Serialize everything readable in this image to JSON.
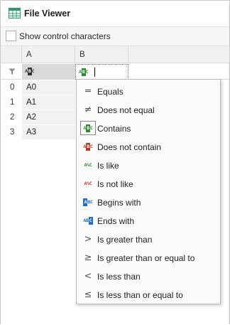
{
  "window": {
    "title": "File Viewer"
  },
  "toolbar": {
    "show_control_characters_label": "Show control characters",
    "show_control_characters_checked": false
  },
  "grid": {
    "columns": [
      "A",
      "B"
    ],
    "rows": [
      {
        "index": "0",
        "a": "A0"
      },
      {
        "index": "1",
        "a": "A1"
      },
      {
        "index": "2",
        "a": "A2"
      },
      {
        "index": "3",
        "a": "A3"
      }
    ],
    "filter": {
      "column_a_operator": "contains",
      "column_b_operator": "contains",
      "column_b_value": ""
    }
  },
  "menu": {
    "items": [
      {
        "label": "Equals",
        "icon": "equals-icon"
      },
      {
        "label": "Does not equal",
        "icon": "not-equal-icon"
      },
      {
        "label": "Contains",
        "icon": "contains-icon",
        "selected": true
      },
      {
        "label": "Does not contain",
        "icon": "does-not-contain-icon"
      },
      {
        "label": "Is like",
        "icon": "is-like-icon"
      },
      {
        "label": "Is not like",
        "icon": "is-not-like-icon"
      },
      {
        "label": "Begins with",
        "icon": "begins-with-icon"
      },
      {
        "label": "Ends with",
        "icon": "ends-with-icon"
      },
      {
        "label": "Is greater than",
        "icon": "greater-than-icon"
      },
      {
        "label": "Is greater than or equal to",
        "icon": "greater-equal-icon"
      },
      {
        "label": "Is less than",
        "icon": "less-than-icon"
      },
      {
        "label": "Is less than or equal to",
        "icon": "less-equal-icon"
      }
    ]
  },
  "colors": {
    "green": "#2e8b2e",
    "red": "#c0392b",
    "blue": "#1e6fc8",
    "dark": "#333333",
    "grid_icon": "#2a9d6a"
  }
}
